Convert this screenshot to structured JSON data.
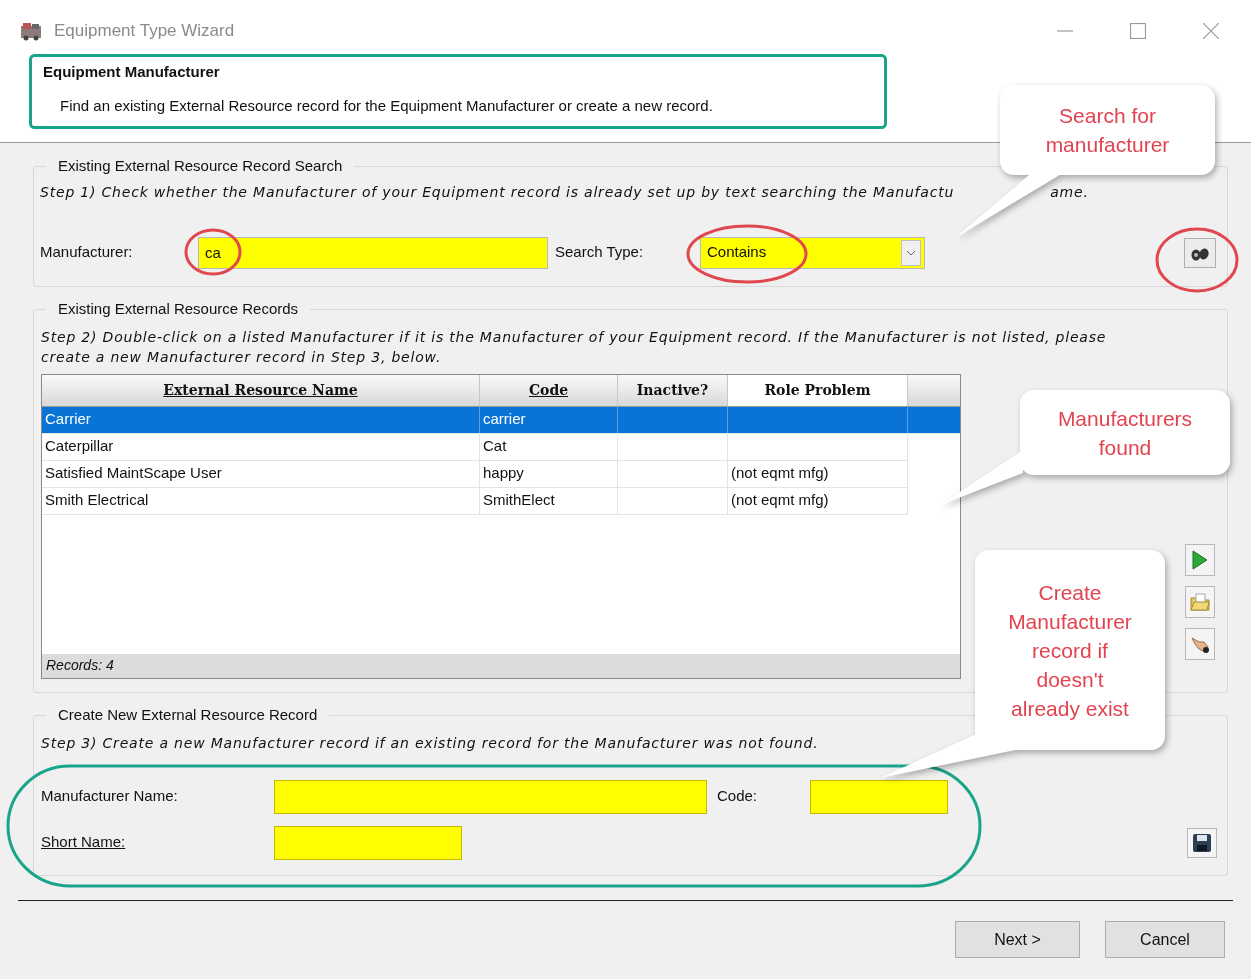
{
  "window": {
    "title": "Equipment Type Wizard"
  },
  "header": {
    "title": "Equipment Manufacturer",
    "description": "Find an existing External Resource record for the Equipment Manufacturer or create a new record."
  },
  "search_group": {
    "legend": "Existing External Resource Record Search",
    "step_parts": [
      "Step 1) Check whether the Manufacturer of your Equipment record is already set up by text searching the Manufactu",
      "ame."
    ],
    "manufacturer_label": "Manufacturer:",
    "manufacturer_value": "ca",
    "search_type_label": "Search Type:",
    "search_type_value": "Contains"
  },
  "records_group": {
    "legend": "Existing External Resource Records",
    "step": "Step 2) Double-click on a listed Manufacturer if it is the Manufacturer of your Equipment record.  If the Manufacturer is not listed, please create a new Manufacturer record in Step 3, below.",
    "table": {
      "columns": [
        {
          "label": "External Resource Name",
          "sortable": true,
          "active": false
        },
        {
          "label": "Code",
          "sortable": true,
          "active": false
        },
        {
          "label": "Inactive?",
          "sortable": false,
          "active": false
        },
        {
          "label": "Role Problem",
          "sortable": false,
          "active": true
        }
      ],
      "rows": [
        {
          "cells": [
            "Carrier",
            "carrier",
            "",
            ""
          ],
          "selected": true
        },
        {
          "cells": [
            "Caterpillar",
            "Cat",
            "",
            ""
          ],
          "selected": false
        },
        {
          "cells": [
            "Satisfied MaintScape User",
            "happy",
            "",
            "(not eqmt mfg)"
          ],
          "selected": false
        },
        {
          "cells": [
            "Smith Electrical",
            "SmithElect",
            "",
            "(not eqmt mfg)"
          ],
          "selected": false
        }
      ],
      "footer": "Records: 4"
    }
  },
  "create_group": {
    "legend": "Create New External Resource Record",
    "step": "Step 3) Create a new Manufacturer record if an existing record for the Manufacturer was not found.",
    "name_label": "Manufacturer Name:",
    "code_label": "Code:",
    "short_name_label": "Short Name:"
  },
  "buttons": [
    {
      "label": "Next >"
    },
    {
      "label": "Cancel"
    }
  ],
  "callouts": [
    {
      "text": "Search for\nmanufacturer"
    },
    {
      "text": "Manufacturers\nfound"
    },
    {
      "text": "Create\nManufacturer\nrecord if\ndoesn't\nalready exist"
    }
  ]
}
